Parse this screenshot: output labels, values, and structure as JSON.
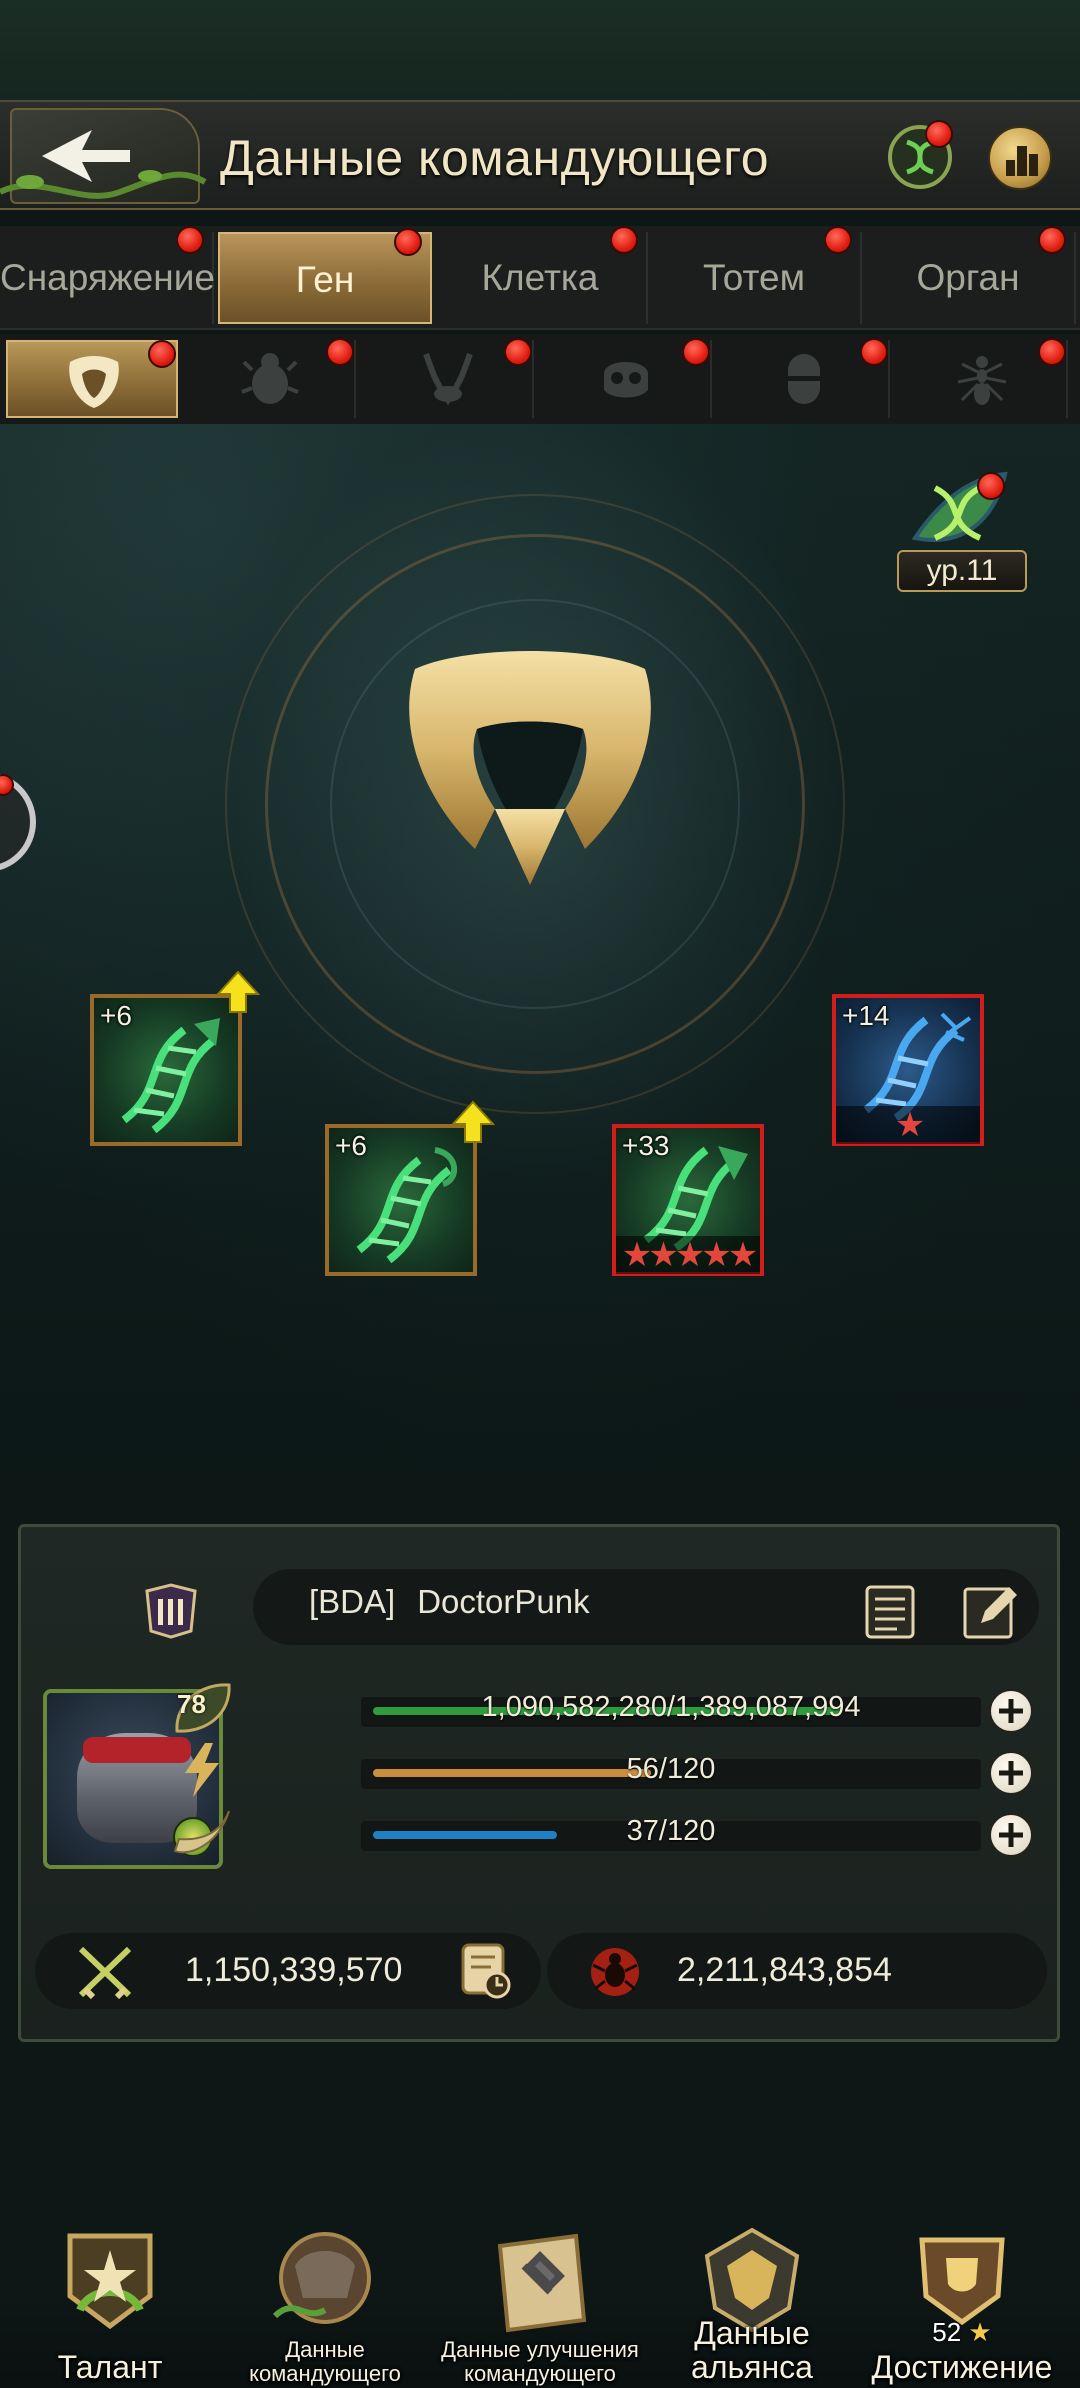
{
  "header": {
    "title": "Данные командующего",
    "back_icon": "back-arrow-icon",
    "gene_icon": "gene-helix-icon",
    "rank_icon": "leaderboard-icon"
  },
  "tabs": [
    {
      "label": "Снаряжение",
      "active": false,
      "dot": true
    },
    {
      "label": "Ген",
      "active": true,
      "dot": true
    },
    {
      "label": "Клетка",
      "active": false,
      "dot": true
    },
    {
      "label": "Тотем",
      "active": false,
      "dot": true
    },
    {
      "label": "Орган",
      "active": false,
      "dot": true
    }
  ],
  "subtabs": [
    {
      "icon": "horned-emblem-icon",
      "active": true
    },
    {
      "icon": "beetle-icon",
      "active": false
    },
    {
      "icon": "mantis-head-icon",
      "active": false
    },
    {
      "icon": "skull-icon",
      "active": false
    },
    {
      "icon": "capsule-icon",
      "active": false
    },
    {
      "icon": "ant-icon",
      "active": false
    }
  ],
  "gene_level": "ур.11",
  "genes": [
    {
      "plus": "+6",
      "color": "green",
      "stars": 0,
      "upgrade": true
    },
    {
      "plus": "+6",
      "color": "green",
      "stars": 0,
      "upgrade": true
    },
    {
      "plus": "+33",
      "color": "green",
      "stars": 5,
      "upgrade": false
    },
    {
      "plus": "+14",
      "color": "blue",
      "stars": 1,
      "upgrade": false
    }
  ],
  "profile": {
    "alliance_tag": "[BDA]",
    "name": "DoctorPunk",
    "level": "78",
    "exp": "1,090,582,280/1,389,087,994",
    "exp_fraction": 0.785,
    "energy": "56/120",
    "energy_fraction": 0.467,
    "stamina": "37/120",
    "stamina_fraction": 0.308,
    "power": "1,150,339,570",
    "kills": "2,211,843,854"
  },
  "colors": {
    "exp_bar": "#2f9b3c",
    "energy_bar": "#c98f3e",
    "stamina_bar": "#1e7fc4",
    "accent_gold": "#b7955a",
    "notify_red": "#e21e12"
  },
  "bottom_nav": {
    "talent": "Талант",
    "commander_data": "Данные командующего",
    "upgrade_data": "Данные улучшения командующего",
    "alliance_data": "Данные альянса",
    "achievement": "Достижение",
    "achievement_count": "52"
  }
}
